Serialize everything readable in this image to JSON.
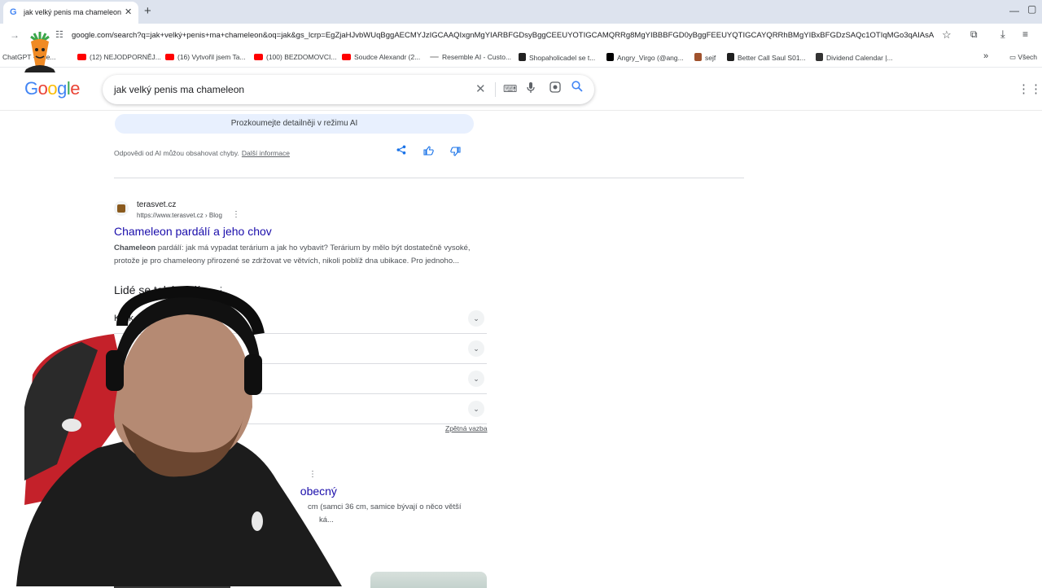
{
  "browser": {
    "tab_title": "jak velký penis ma chameleon",
    "tab_favicon": "G",
    "new_tab_icon": "+",
    "close_icon": "✕",
    "url": "google.com/search?q=jak+velký+penis+ma+chameleon&oq=jak&gs_lcrp=EgZjaHJvbWUqBggAECMYJzIGCAAQIxgnMgYIARBFGDsyBggCEEUYOTIGCAMQRRg8MgYIBBBFGD0yBggFEEUYQTIGCAYQRRhBMgYIBxBFGDzSAQc1OTIqMGo3qAIAsAIA..."
  },
  "bookmarks": [
    {
      "label": "ChatGPT - Jide...",
      "color": "#10a37f"
    },
    {
      "label": "(12) NEJODPORNĚJ...",
      "color": "#ff0000"
    },
    {
      "label": "(16) Vytvořil jsem Ta...",
      "color": "#ff0000"
    },
    {
      "label": "(100) BEZDOMOVCI...",
      "color": "#ff0000"
    },
    {
      "label": "Soudce Alexandr (2...",
      "color": "#ff0000"
    },
    {
      "label": "Resemble AI - Custo...",
      "color": "#bdbdbd"
    },
    {
      "label": "Shopaholicadel se t...",
      "color": "#222222"
    },
    {
      "label": "Angry_Virgo (@ang...",
      "color": "#000000"
    },
    {
      "label": "sejf",
      "color": "#a0522d"
    },
    {
      "label": "Better Call Saul S01...",
      "color": "#1f1f1f"
    },
    {
      "label": "Dividend Calendar |...",
      "color": "#333333"
    }
  ],
  "bookmarks_more": "»",
  "bookmarks_folder": "Všech",
  "google": {
    "logo": [
      "G",
      "o",
      "o",
      "g",
      "l",
      "e"
    ],
    "query": "jak velký penis ma chameleon"
  },
  "ai": {
    "mode_button": "Prozkoumejte detailněji v režimu AI",
    "disclaimer": "Odpovědi od AI můžou obsahovat chyby.",
    "more_info": "Další informace"
  },
  "result1": {
    "site": "terasvet.cz",
    "url": "https://www.terasvet.cz › Blog",
    "title": "Chameleon pardálí a jeho chov",
    "snippet_bold": "Chameleon",
    "snippet": " pardálí: jak má vypadat terárium a jak ho vybavit? Terárium by mělo být dostatečně vysoké, protože je pro chameleony přirozené se zdržovat ve větvích, nikoli poblíž dna ubikace. Pro jednoho..."
  },
  "people_also_ask": {
    "title": "Lidé se také ptají",
    "questions": [
      "Kolik",
      "",
      "",
      ""
    ],
    "feedback": "Zpětná vazba"
  },
  "result2": {
    "title_visible": "obecný",
    "snippet_line1": "cm (samci 36 cm, samice bývají o něco větší",
    "snippet_line2": "ká..."
  }
}
